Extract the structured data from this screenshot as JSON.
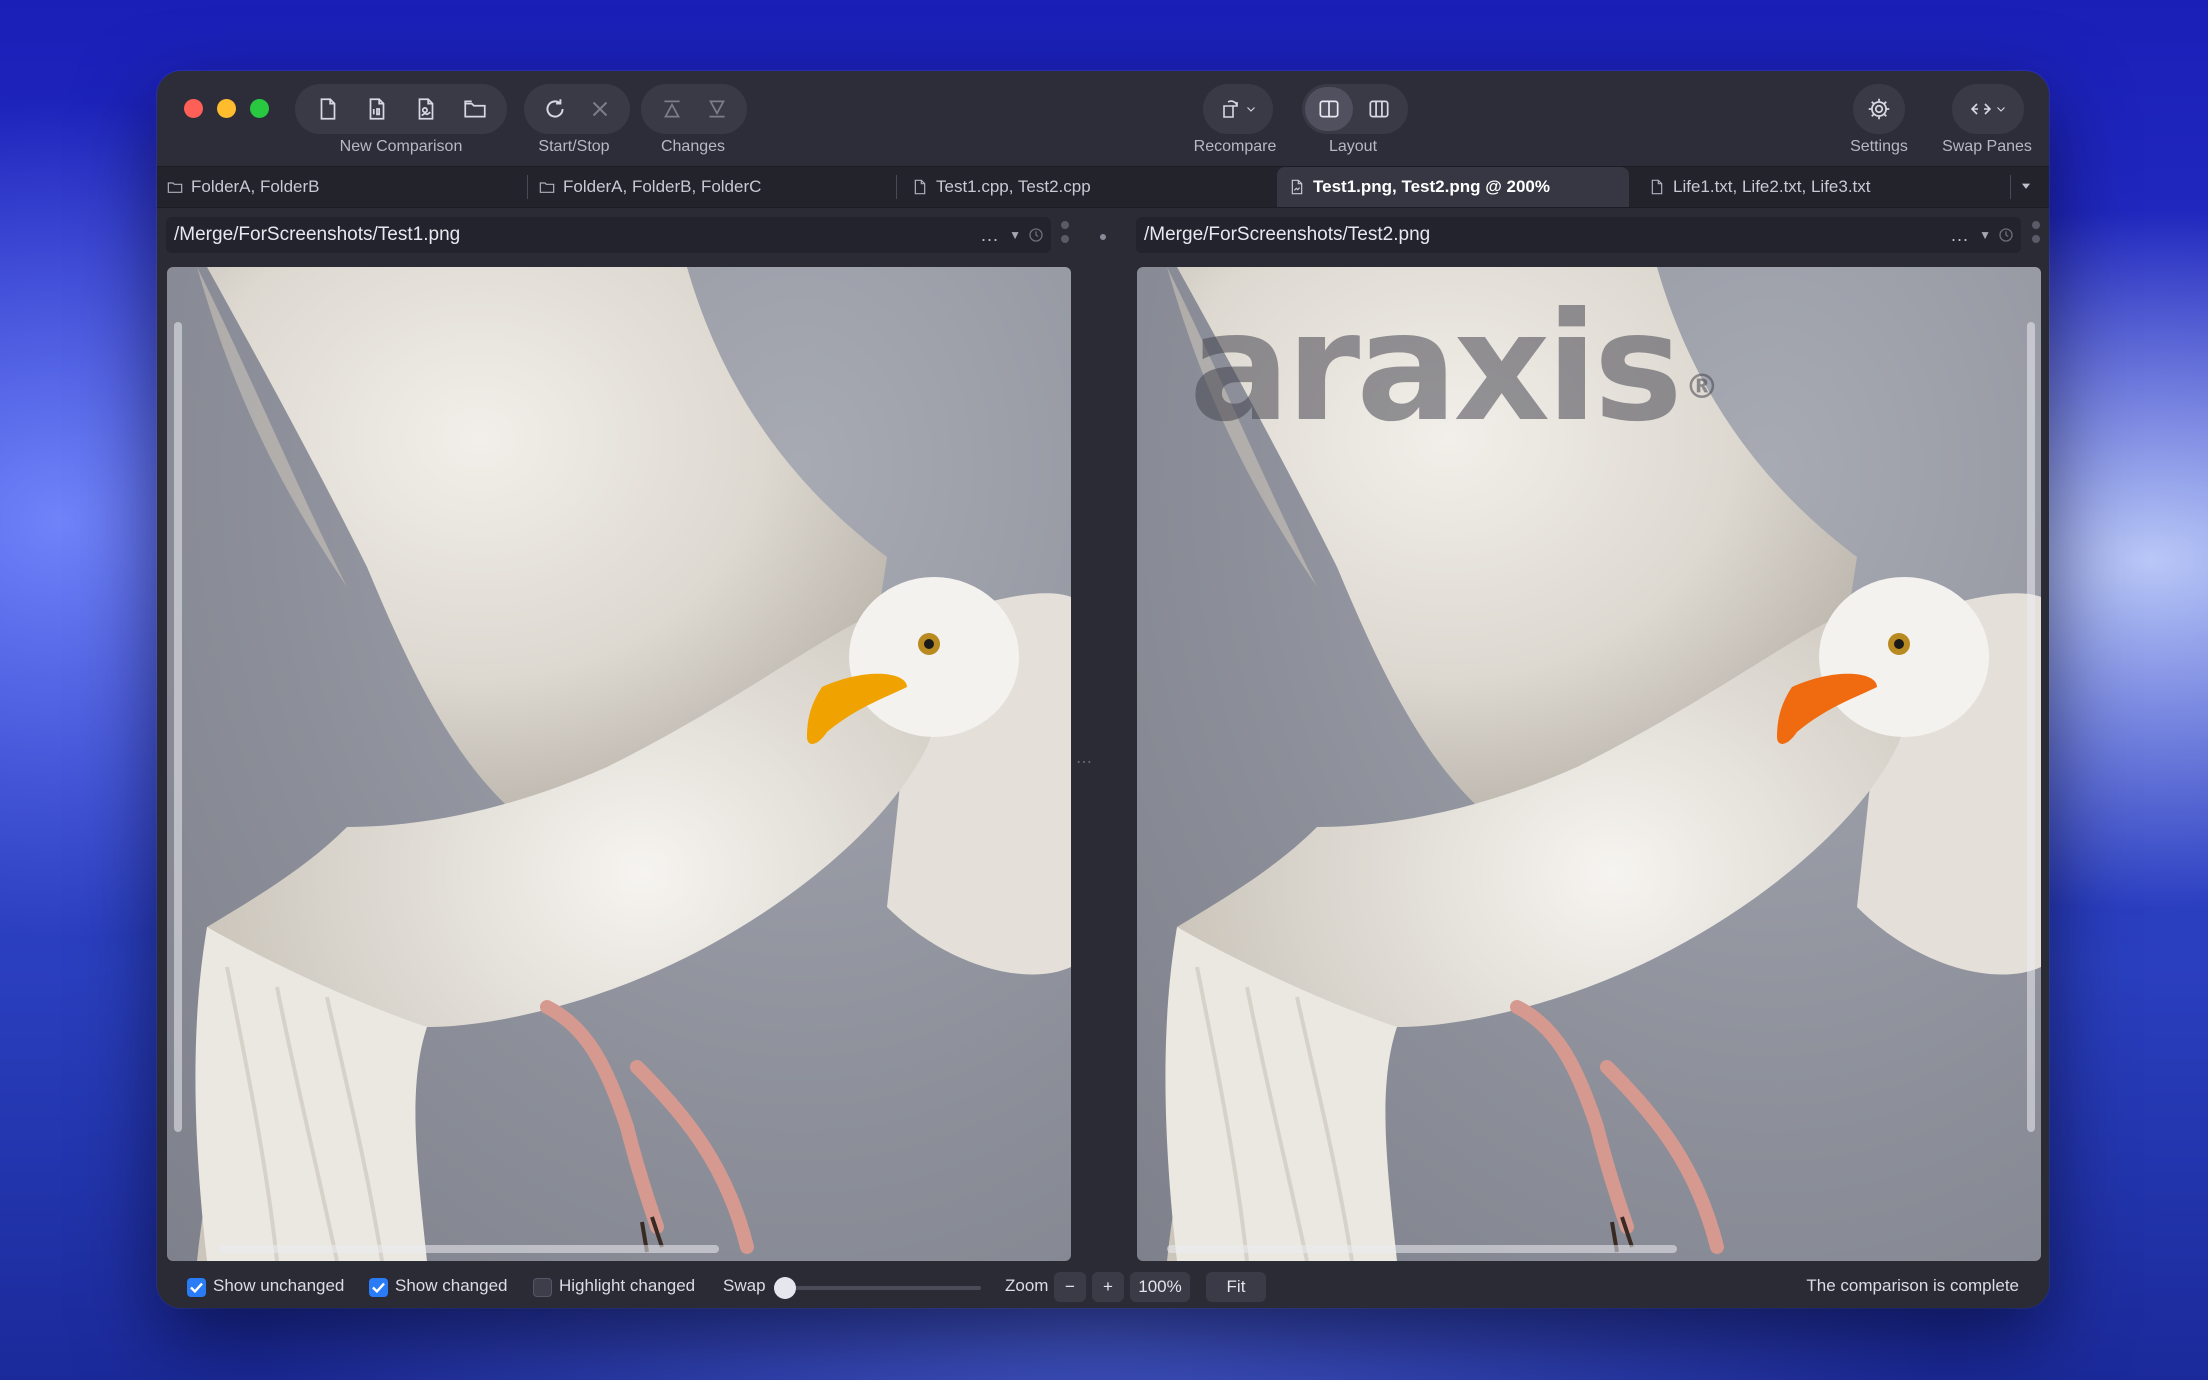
{
  "toolbar": {
    "groups": {
      "new_comparison": "New Comparison",
      "start_stop": "Start/Stop",
      "changes": "Changes",
      "recompare": "Recompare",
      "layout": "Layout",
      "settings": "Settings",
      "swap_panes": "Swap Panes"
    }
  },
  "tabs": [
    {
      "label": "FolderA, FolderB",
      "icon": "folder-icon"
    },
    {
      "label": "FolderA, FolderB, FolderC",
      "icon": "folder-icon"
    },
    {
      "label": "Test1.cpp, Test2.cpp",
      "icon": "document-icon"
    },
    {
      "label": "Test1.png, Test2.png @ 200%",
      "icon": "image-document-icon",
      "active": true
    },
    {
      "label": "Life1.txt, Life2.txt, Life3.txt",
      "icon": "document-icon"
    }
  ],
  "panes": {
    "left": {
      "path": "/Merge/ForScreenshots/Test1.png",
      "more": "..."
    },
    "right": {
      "path": "/Merge/ForScreenshots/Test2.png",
      "more": "...",
      "watermark": "araxis"
    }
  },
  "status": {
    "show_unchanged": "Show unchanged",
    "show_changed": "Show changed",
    "highlight_changed": "Highlight changed",
    "swap": "Swap",
    "zoom": "Zoom",
    "zoom_minus": "−",
    "zoom_plus": "+",
    "zoom_value": "100%",
    "fit": "Fit",
    "message": "The comparison is complete",
    "show_unchanged_checked": true,
    "show_changed_checked": true,
    "highlight_changed_checked": false
  },
  "colors": {
    "accent": "#2a7cf6",
    "window_bg": "#2b2b36"
  }
}
